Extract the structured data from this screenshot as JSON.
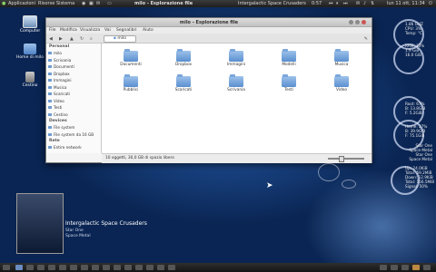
{
  "top_panel": {
    "menu_apps": "Applicazioni",
    "menu_places": "Risorse",
    "menu_system": "Sistema",
    "active_window": "milo - Esplorazione file",
    "now_playing": "Intergalactic Space Crusaders",
    "time": "0:57",
    "clock": "lun 11 ott, 11:34"
  },
  "desktop_icons": [
    "Computer",
    "Home di milo",
    "Cestino"
  ],
  "window": {
    "title": "milo - Esplorazione file",
    "menu": [
      "File",
      "Modifica",
      "Visualizza",
      "Vai",
      "Segnalibri",
      "Aiuto"
    ],
    "location": "milo",
    "sidebar": {
      "sections": [
        {
          "heading": "Personal",
          "items": [
            "milo",
            "Scrivania",
            "Documenti",
            "Dropbox",
            "Immagini",
            "Musica",
            "Scaricati",
            "Video",
            "Testi",
            "Cestino"
          ]
        },
        {
          "heading": "Devices",
          "items": [
            "File system",
            "File system da 16 GB"
          ]
        },
        {
          "heading": "Rete",
          "items": [
            "Entire network"
          ]
        }
      ]
    },
    "folders": [
      "Documenti",
      "Dropbox",
      "Immagini",
      "Modelli",
      "Musica",
      "Pubblici",
      "Scaricati",
      "Scrivania",
      "Testi",
      "Video"
    ],
    "status": "10 oggetti, 30,0 GB di spazio libero"
  },
  "conky": {
    "cpu": [
      "1.86 GHZ",
      "CPU: 3%",
      "Temp: °C"
    ],
    "ram": [
      "RAM: 33%",
      "1.9 GiB",
      "16.0 GiB"
    ],
    "root": [
      "Root: 67%",
      "B: 13.8GiB",
      "F: 5.2GiB"
    ],
    "home": [
      "Home: 27%",
      "B: 39.9GiB",
      "F: 75.1GiB"
    ],
    "song": [
      "Star One",
      "Space Metal",
      "Star One",
      "Space Metal",
      "Star One",
      "Space Metal"
    ],
    "net": [
      "Up: 24.0KiB",
      "Total: 59.2MiB",
      "Down: 12.9KiB",
      "Total: 156.5MiB",
      "Signal: 50%"
    ]
  },
  "now_playing": {
    "title": "Intergalactic Space Crusaders",
    "artist": "Star One",
    "album": "Space Metal"
  },
  "colors": {
    "accent": "#5a8fcf",
    "panel": "#262626"
  }
}
